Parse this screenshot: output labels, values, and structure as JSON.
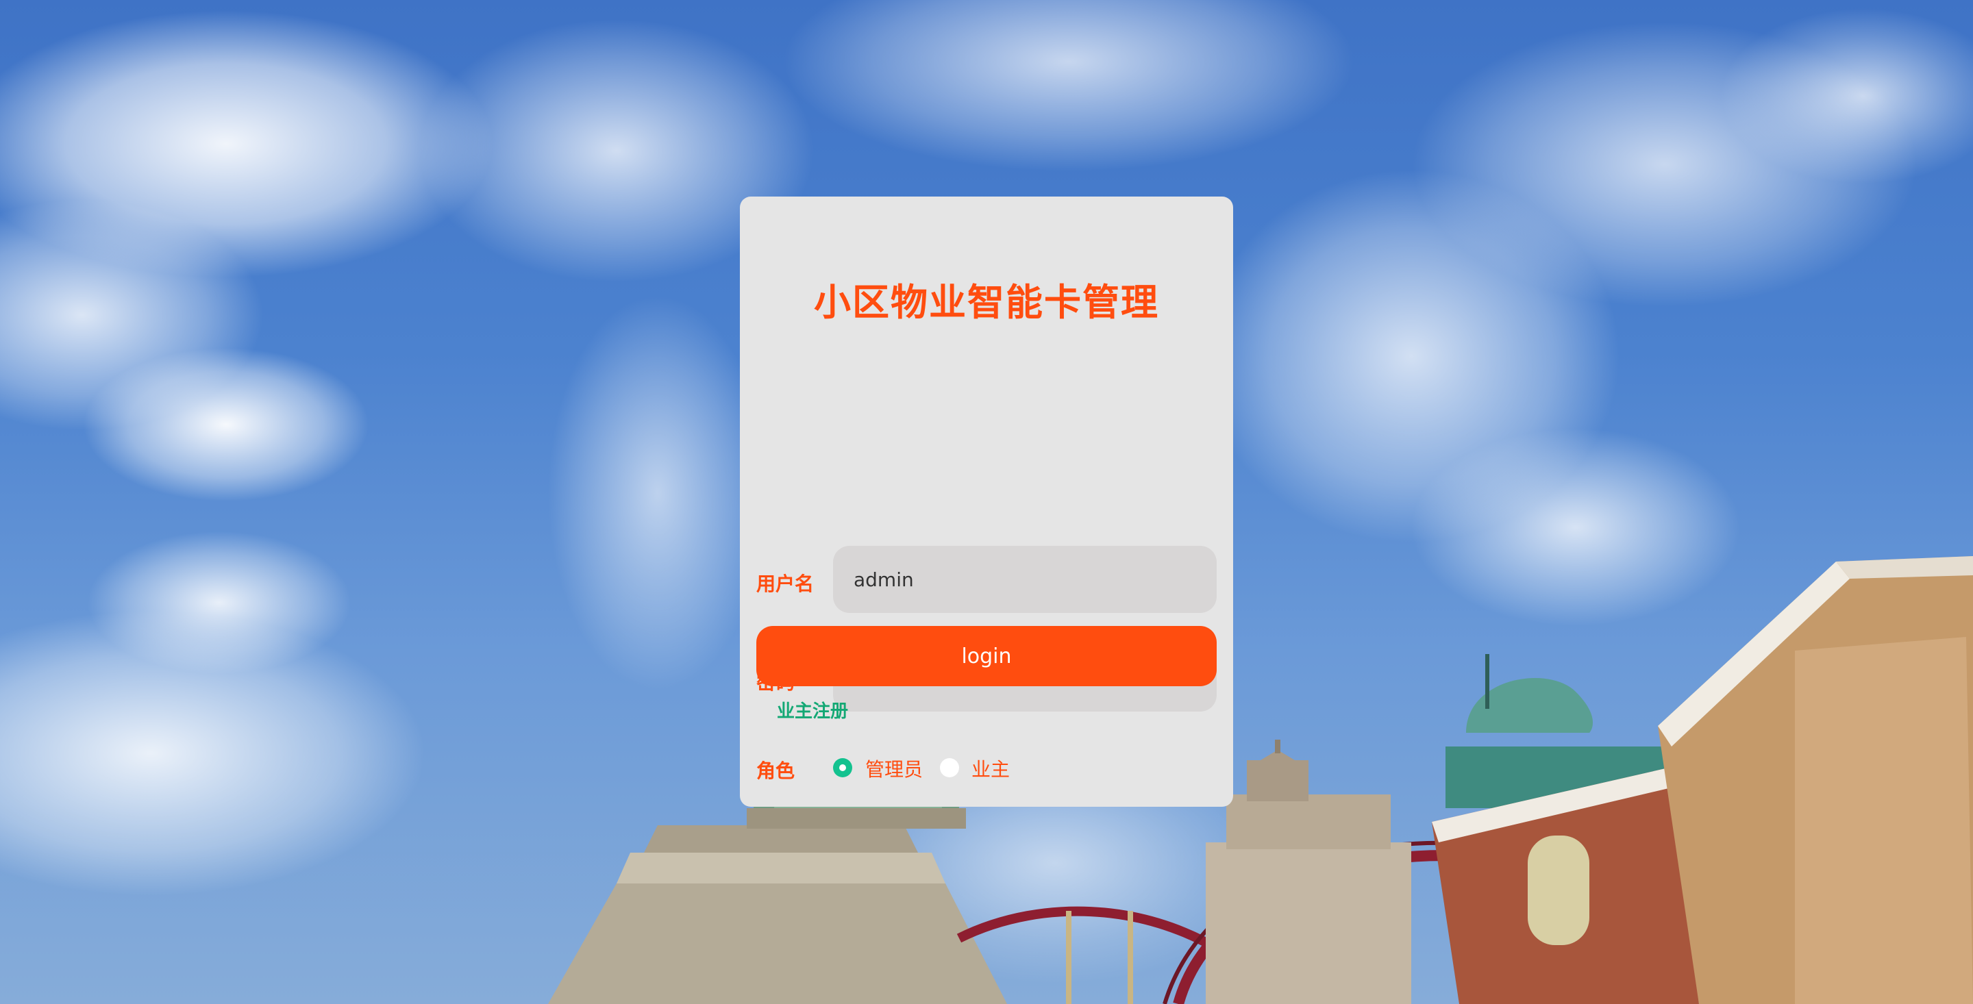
{
  "page": {
    "title": "小区物业智能卡管理"
  },
  "form": {
    "username_label": "用户名",
    "username_value": "admin",
    "password_label": "密码",
    "password_value": "•••••",
    "role_label": "角色",
    "role_options": [
      {
        "label": "管理员",
        "selected": true
      },
      {
        "label": "业主",
        "selected": false
      }
    ],
    "login_button": "login",
    "register_link": "业主注册"
  },
  "colors": {
    "accent": "#ff4d0f",
    "radio_selected": "#13c28f",
    "link": "#13a874",
    "card_background": "#e5e5e5",
    "input_background": "#d8d6d6"
  },
  "icons": {
    "radio_selected": "radio-checked-icon",
    "radio_unselected": "radio-unchecked-icon"
  }
}
